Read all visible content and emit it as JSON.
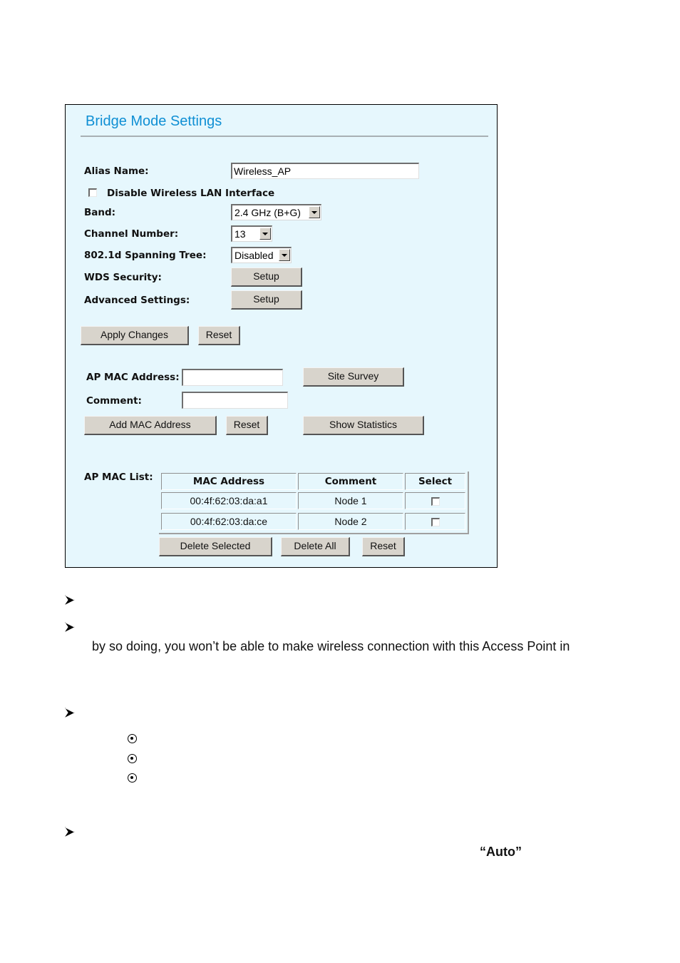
{
  "panel": {
    "title": "Bridge Mode Settings",
    "alias_name": {
      "label": "Alias Name:",
      "value": "Wireless_AP"
    },
    "disable_wlan": {
      "label": "Disable Wireless LAN Interface",
      "checked": false
    },
    "band": {
      "label": "Band:",
      "selected": "2.4 GHz (B+G)"
    },
    "channel": {
      "label": "Channel Number:",
      "selected": "13"
    },
    "spanning_tree": {
      "label": "802.1d Spanning Tree:",
      "selected": "Disabled"
    },
    "wds_security": {
      "label": "WDS Security:",
      "button": "Setup"
    },
    "advanced_settings": {
      "label": "Advanced Settings:",
      "button": "Setup"
    },
    "apply_button": "Apply Changes",
    "reset_button": "Reset",
    "ap_mac": {
      "label": "AP MAC Address:",
      "value": ""
    },
    "comment": {
      "label": "Comment:",
      "value": ""
    },
    "site_survey_button": "Site Survey",
    "add_mac_button": "Add MAC Address",
    "reset2_button": "Reset",
    "show_statistics_button": "Show Statistics",
    "mac_list": {
      "label": "AP MAC List:",
      "headers": [
        "MAC Address",
        "Comment",
        "Select"
      ],
      "rows": [
        {
          "mac": "00:4f:62:03:da:a1",
          "comment": "Node 1",
          "selected": false
        },
        {
          "mac": "00:4f:62:03:da:ce",
          "comment": "Node 2",
          "selected": false
        }
      ]
    },
    "delete_selected_button": "Delete Selected",
    "delete_all_button": "Delete All",
    "reset3_button": "Reset"
  },
  "document": {
    "line_continuation": "by so doing, you won’t be able to make wireless connection with this Access Point in",
    "auto_text": "“Auto”",
    "arrow_bullets": 4,
    "circle_bullets": 3
  },
  "colors": {
    "panel_bg": "#e6f7fd",
    "title": "#0f8fd4",
    "button_face": "#d8d4cc"
  }
}
